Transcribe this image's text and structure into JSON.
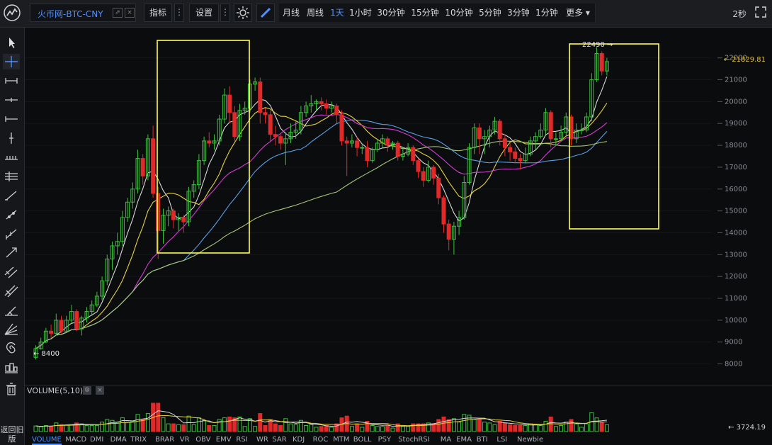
{
  "toolbar": {
    "symbol": "火币网-BTC-CNY",
    "indicators_label": "指标",
    "settings_label": "设置",
    "periods": [
      "月线",
      "周线",
      "1天",
      "1小时",
      "30分钟",
      "15分钟",
      "10分钟",
      "5分钟",
      "3分钟",
      "1分钟",
      "更多"
    ],
    "active_period": "1天",
    "refresh": "2秒"
  },
  "price_axis": {
    "ticks": [
      "22000",
      "21000",
      "20000",
      "19000",
      "18000",
      "17000",
      "16000",
      "15000",
      "14000",
      "13000",
      "12000",
      "11000",
      "10000",
      "9000",
      "8000"
    ],
    "last_price": "← 21829.81"
  },
  "annotations": {
    "high": "22490 →",
    "low": "← 8400"
  },
  "volume": {
    "label": "VOLUME(5,10)",
    "last": "← 3724.19"
  },
  "indicator_tabs": [
    "VOLUME",
    "MACD",
    "DMI",
    "DMA",
    "TRIX",
    "BRAR",
    "VR",
    "OBV",
    "EMV",
    "RSI",
    "WR",
    "SAR",
    "KDJ",
    "ROC",
    "MTM",
    "BOLL",
    "PSY",
    "StochRSI",
    "MA",
    "EMA",
    "BTI",
    "LSI",
    "Newbie"
  ],
  "active_tab": "VOLUME",
  "back_label": "返回旧版",
  "colors": {
    "up": "#3cbf3c",
    "down": "#e02a2a",
    "ma5": "#d8d8d8",
    "ma10": "#e6d23c",
    "ma20": "#d23cd2",
    "ma30": "#5aa0e6",
    "ma60": "#a8c878",
    "highlight": "#ffff4d",
    "accent": "#4f8fff"
  },
  "chart_data": {
    "type": "candlestick",
    "ylim": [
      7500,
      22800
    ],
    "candles": [
      [
        8300,
        8700,
        8200,
        8850
      ],
      [
        8700,
        9000,
        8650,
        9200
      ],
      [
        9000,
        9500,
        8950,
        9650
      ],
      [
        9500,
        9400,
        9200,
        9800
      ],
      [
        9400,
        10000,
        9300,
        10300
      ],
      [
        10000,
        9500,
        9400,
        10200
      ],
      [
        9500,
        10000,
        9450,
        10200
      ],
      [
        10000,
        10400,
        9900,
        10700
      ],
      [
        10400,
        9600,
        9500,
        10500
      ],
      [
        9600,
        10100,
        9300,
        10200
      ],
      [
        10100,
        10400,
        9900,
        10600
      ],
      [
        10400,
        10700,
        10200,
        10900
      ],
      [
        10700,
        11100,
        10600,
        11300
      ],
      [
        11100,
        11800,
        10900,
        12000
      ],
      [
        11800,
        12800,
        11600,
        13000
      ],
      [
        12800,
        13400,
        12300,
        13600
      ],
      [
        13400,
        13600,
        13000,
        14000
      ],
      [
        13600,
        14700,
        13400,
        15000
      ],
      [
        14700,
        15400,
        14500,
        15600
      ],
      [
        15400,
        16000,
        15100,
        16300
      ],
      [
        16000,
        17400,
        15800,
        17800
      ],
      [
        17400,
        16600,
        16200,
        17600
      ],
      [
        16600,
        18300,
        16400,
        18500
      ],
      [
        18300,
        15800,
        15600,
        18900
      ],
      [
        15800,
        14100,
        12800,
        16100
      ],
      [
        14100,
        14800,
        13500,
        15100
      ],
      [
        14800,
        15000,
        14300,
        15200
      ],
      [
        15000,
        14600,
        14200,
        15100
      ],
      [
        14600,
        14700,
        14100,
        14900
      ],
      [
        14700,
        14500,
        14000,
        14800
      ],
      [
        14500,
        15900,
        14300,
        16100
      ],
      [
        15900,
        16200,
        15600,
        16400
      ],
      [
        16200,
        17300,
        16000,
        17600
      ],
      [
        17300,
        18200,
        17100,
        18400
      ],
      [
        18200,
        18100,
        17900,
        18600
      ],
      [
        18100,
        18200,
        17800,
        18500
      ],
      [
        18200,
        19200,
        18000,
        19400
      ],
      [
        19200,
        20300,
        19000,
        20600
      ],
      [
        20300,
        19500,
        19000,
        20700
      ],
      [
        19500,
        18400,
        18200,
        19800
      ],
      [
        18400,
        19600,
        18200,
        19900
      ],
      [
        19600,
        19700,
        19400,
        20000
      ],
      [
        19700,
        20800,
        19500,
        21000
      ],
      [
        20800,
        20900,
        20500,
        21100
      ],
      [
        20900,
        19500,
        19000,
        21100
      ],
      [
        19500,
        19400,
        19000,
        19700
      ],
      [
        19400,
        18500,
        18200,
        19600
      ],
      [
        18500,
        18400,
        18000,
        18900
      ],
      [
        18400,
        18100,
        17800,
        18500
      ],
      [
        18100,
        18300,
        17100,
        18600
      ],
      [
        18300,
        18600,
        18100,
        19000
      ],
      [
        18600,
        18700,
        18300,
        19100
      ],
      [
        18700,
        19500,
        18500,
        19800
      ],
      [
        19500,
        19800,
        19300,
        20000
      ],
      [
        19800,
        19900,
        19500,
        20300
      ],
      [
        19900,
        20000,
        19600,
        20100
      ],
      [
        20000,
        19900,
        19600,
        20200
      ],
      [
        19900,
        19700,
        19400,
        20100
      ],
      [
        19700,
        19800,
        19500,
        20000
      ],
      [
        19800,
        19400,
        19000,
        19900
      ],
      [
        19400,
        18200,
        18000,
        19600
      ],
      [
        18200,
        18100,
        16600,
        18400
      ],
      [
        18100,
        18200,
        17900,
        18500
      ],
      [
        18200,
        17900,
        17500,
        18400
      ],
      [
        17900,
        17900,
        17600,
        18100
      ],
      [
        17900,
        17300,
        17000,
        18200
      ],
      [
        17300,
        17800,
        17200,
        17900
      ],
      [
        17800,
        18100,
        17700,
        18300
      ],
      [
        18100,
        18300,
        17900,
        18500
      ],
      [
        18300,
        18000,
        17700,
        18400
      ],
      [
        18000,
        18100,
        17800,
        18200
      ],
      [
        18100,
        17500,
        17300,
        18200
      ],
      [
        17500,
        17600,
        17300,
        17900
      ],
      [
        17600,
        17900,
        17500,
        18100
      ],
      [
        17900,
        17300,
        17100,
        18000
      ],
      [
        17300,
        16800,
        16500,
        17400
      ],
      [
        16800,
        16400,
        16100,
        17000
      ],
      [
        16400,
        17000,
        16300,
        17300
      ],
      [
        17000,
        16500,
        16200,
        17100
      ],
      [
        16500,
        15600,
        15300,
        16700
      ],
      [
        15600,
        14400,
        14000,
        15700
      ],
      [
        14400,
        13700,
        13200,
        14600
      ],
      [
        13700,
        14300,
        13000,
        14500
      ],
      [
        14300,
        14700,
        13900,
        15000
      ],
      [
        14700,
        16300,
        14600,
        16600
      ],
      [
        16300,
        17900,
        16200,
        18100
      ],
      [
        17900,
        18800,
        17600,
        19000
      ],
      [
        18800,
        18300,
        17600,
        19000
      ],
      [
        18300,
        18400,
        17600,
        18700
      ],
      [
        18400,
        18700,
        17900,
        18900
      ],
      [
        18700,
        19100,
        18500,
        19300
      ],
      [
        19100,
        18300,
        18000,
        19200
      ],
      [
        18300,
        17900,
        17500,
        18500
      ],
      [
        17900,
        17700,
        17300,
        18100
      ],
      [
        17700,
        17400,
        17200,
        17900
      ],
      [
        17400,
        17300,
        16900,
        17600
      ],
      [
        17300,
        17600,
        17200,
        17900
      ],
      [
        17600,
        18200,
        17500,
        18400
      ],
      [
        18200,
        18400,
        17800,
        18600
      ],
      [
        18400,
        18700,
        18300,
        19000
      ],
      [
        18700,
        19500,
        18500,
        19700
      ],
      [
        19500,
        18300,
        17900,
        19600
      ],
      [
        18300,
        18300,
        18000,
        18600
      ],
      [
        18300,
        18600,
        18200,
        18900
      ],
      [
        18600,
        19300,
        18400,
        19500
      ],
      [
        19300,
        18300,
        18000,
        19400
      ],
      [
        18300,
        18700,
        18100,
        19000
      ],
      [
        18700,
        18700,
        18500,
        19000
      ],
      [
        18700,
        19300,
        18600,
        19500
      ],
      [
        19300,
        21000,
        19100,
        21300
      ],
      [
        21000,
        22200,
        20900,
        22490
      ],
      [
        22200,
        21400,
        21200,
        22300
      ],
      [
        21400,
        21830,
        21200,
        22000
      ]
    ],
    "volume_ylim": [
      0,
      9000
    ]
  }
}
